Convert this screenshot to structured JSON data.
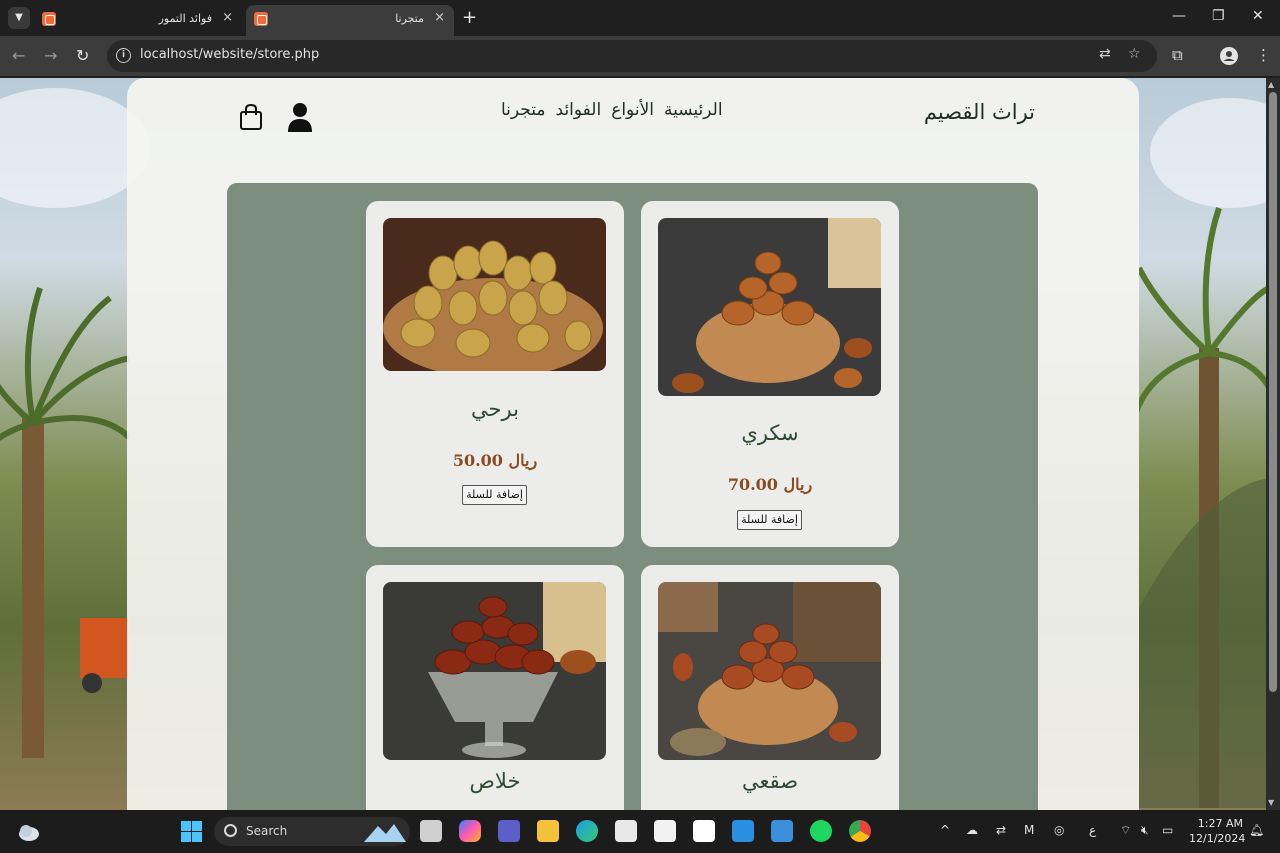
{
  "browser": {
    "tabs": [
      {
        "title": "فوائد التمور",
        "active": false
      },
      {
        "title": "متجرنا",
        "active": true
      }
    ],
    "url": "localhost/website/store.php",
    "close_glyph": "×",
    "new_tab_glyph": "+"
  },
  "site": {
    "brand": "تراث القصيم",
    "nav": [
      "الرئيسية",
      "الأنواع",
      "الفوائد",
      "متجرنا"
    ]
  },
  "products": [
    {
      "name": "برحي",
      "price": "ريال 50.00",
      "button": "إضافة للسلة"
    },
    {
      "name": "سكري",
      "price": "ريال 70.00",
      "button": "إضافة للسلة"
    },
    {
      "name": "خلاص",
      "price": "",
      "button": ""
    },
    {
      "name": "صقعي",
      "price": "",
      "button": ""
    }
  ],
  "taskbar": {
    "search_label": "Search",
    "lang": "ع",
    "time": "1:27 AM",
    "date": "12/1/2024"
  },
  "colors": {
    "panel": "#7c8e7d",
    "brand_text": "#1f2e22",
    "price_text": "#8a4b22",
    "chrome_bg": "#1f1f1f"
  }
}
